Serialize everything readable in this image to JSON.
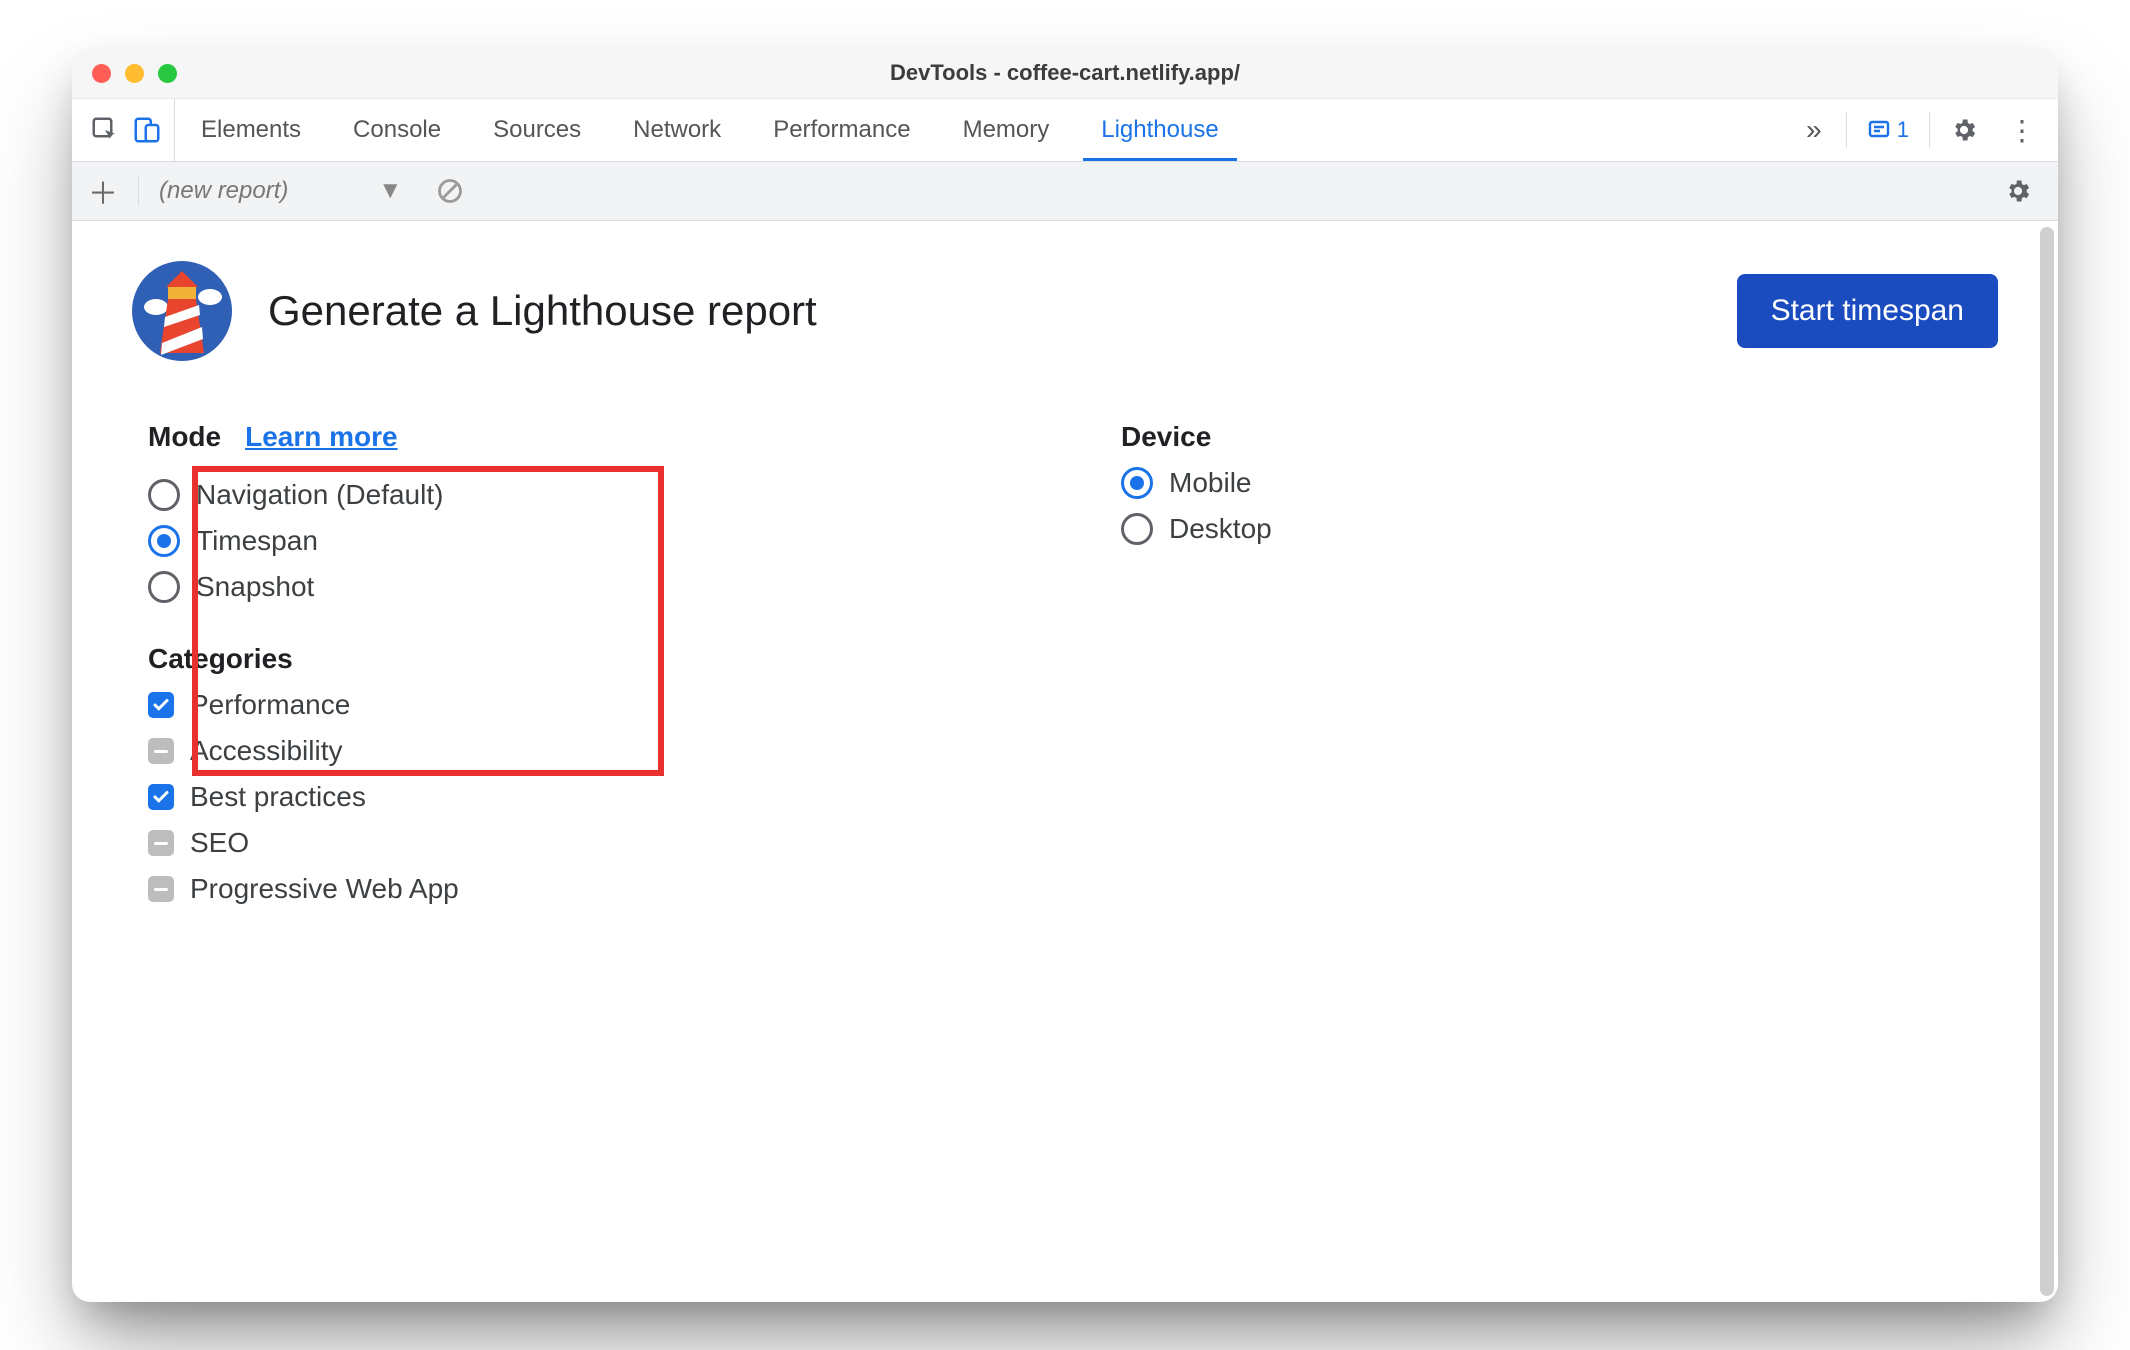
{
  "window": {
    "title": "DevTools - coffee-cart.netlify.app/"
  },
  "tabs": {
    "items": [
      "Elements",
      "Console",
      "Sources",
      "Network",
      "Performance",
      "Memory",
      "Lighthouse"
    ],
    "active_index": 6,
    "overflow_glyph": "»",
    "issues_count": "1"
  },
  "toolbar": {
    "new_report_label": "(new report)"
  },
  "header": {
    "title": "Generate a Lighthouse report",
    "primary_button": "Start timespan"
  },
  "mode": {
    "title": "Mode",
    "learn_more": "Learn more",
    "options": [
      {
        "label": "Navigation (Default)",
        "checked": false
      },
      {
        "label": "Timespan",
        "checked": true
      },
      {
        "label": "Snapshot",
        "checked": false
      }
    ]
  },
  "device": {
    "title": "Device",
    "options": [
      {
        "label": "Mobile",
        "checked": true
      },
      {
        "label": "Desktop",
        "checked": false
      }
    ]
  },
  "categories": {
    "title": "Categories",
    "items": [
      {
        "label": "Performance",
        "state": "checked"
      },
      {
        "label": "Accessibility",
        "state": "indeterminate"
      },
      {
        "label": "Best practices",
        "state": "checked"
      },
      {
        "label": "SEO",
        "state": "indeterminate"
      },
      {
        "label": "Progressive Web App",
        "state": "indeterminate"
      }
    ]
  },
  "colors": {
    "accent": "#1a73e8",
    "primary_button": "#1a4bbf",
    "highlight_box": "#e8302e"
  }
}
